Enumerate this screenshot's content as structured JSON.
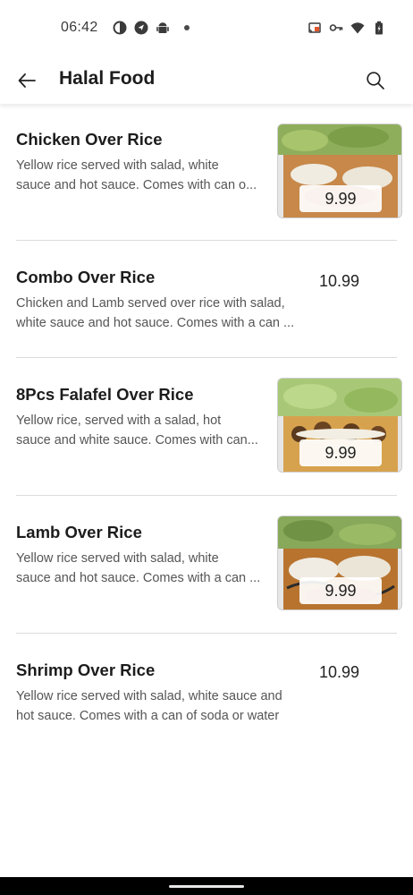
{
  "status_bar": {
    "time": "06:42",
    "left_icons": [
      "circle-half-icon",
      "nav-arrow-icon",
      "android-icon"
    ],
    "right_icons": [
      "cast-icon",
      "vpn-key-icon",
      "wifi-icon",
      "battery-icon"
    ]
  },
  "app_bar": {
    "title": "Halal Food",
    "back_icon": "arrow-left-icon",
    "search_icon": "search-icon"
  },
  "menu": {
    "items": [
      {
        "name": "Chicken Over Rice",
        "description_line1": "Yellow rice served with salad, white",
        "description_line2": "sauce and hot sauce. Comes with can o...",
        "price": "9.99",
        "has_image": true
      },
      {
        "name": "Combo Over Rice",
        "description_line1": "Chicken and Lamb served over rice with salad,",
        "description_line2": "white sauce and hot sauce. Comes with a can ...",
        "price": "10.99",
        "has_image": false
      },
      {
        "name": "8Pcs Falafel Over Rice",
        "description_line1": "Yellow rice, served with a salad, hot",
        "description_line2": "sauce and white sauce. Comes with can...",
        "price": "9.99",
        "has_image": true
      },
      {
        "name": "Lamb Over Rice",
        "description_line1": "Yellow rice served with salad, white",
        "description_line2": "sauce and hot sauce. Comes with a can ...",
        "price": "9.99",
        "has_image": true
      },
      {
        "name": "Shrimp Over Rice",
        "description_line1": "Yellow rice served with salad, white sauce and",
        "description_line2": "hot sauce. Comes with a can of soda or water",
        "price": "10.99",
        "has_image": false
      }
    ]
  },
  "colors": {
    "divider": "#dcdcdc",
    "text_primary": "#1c1c1c",
    "text_secondary": "#555555",
    "nav_bar": "#000000"
  }
}
